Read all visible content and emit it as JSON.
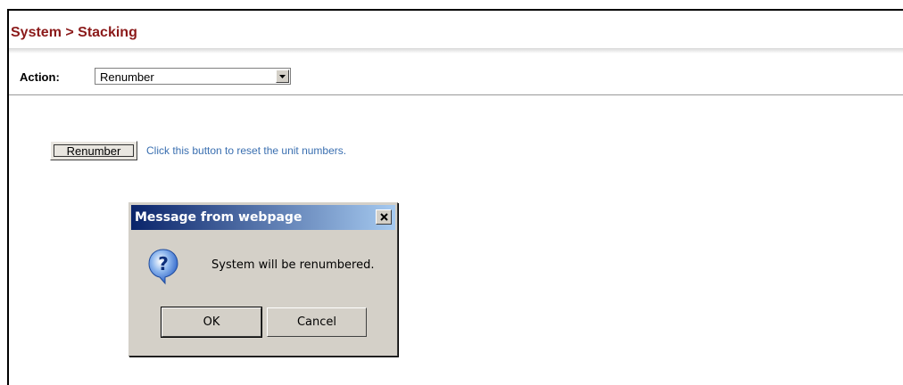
{
  "page": {
    "title": "System > Stacking"
  },
  "action": {
    "label": "Action:",
    "selected": "Renumber"
  },
  "renumber": {
    "button_label": "Renumber",
    "hint": "Click this button to reset the unit numbers."
  },
  "dialog": {
    "title": "Message from webpage",
    "message": "System will be renumbered.",
    "ok_label": "OK",
    "cancel_label": "Cancel",
    "icon": "question-icon"
  },
  "colors": {
    "title": "#8b1a1a",
    "hint": "#3a6fb0",
    "dialog_titlebar": "#0a246a"
  }
}
